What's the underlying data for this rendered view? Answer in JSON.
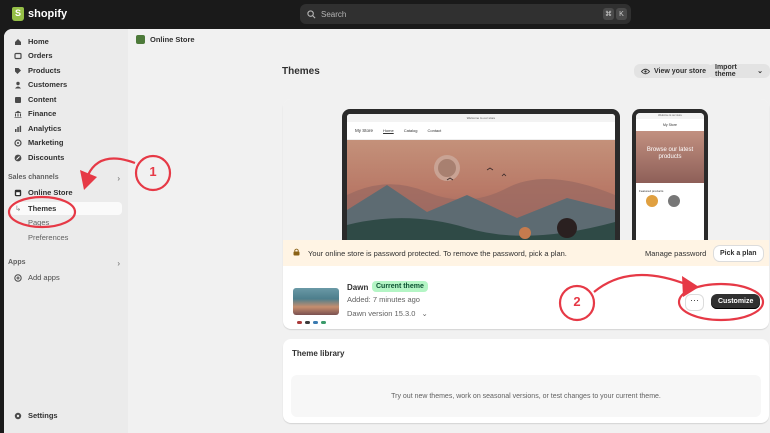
{
  "topbar": {
    "brand": "shopify",
    "search_placeholder": "Search",
    "shortcut_keys": [
      "⌘",
      "K"
    ]
  },
  "sidebar": {
    "items": [
      {
        "label": "Home",
        "icon": "home-icon"
      },
      {
        "label": "Orders",
        "icon": "orders-icon"
      },
      {
        "label": "Products",
        "icon": "tag-icon"
      },
      {
        "label": "Customers",
        "icon": "person-icon"
      },
      {
        "label": "Content",
        "icon": "content-icon"
      },
      {
        "label": "Finance",
        "icon": "bank-icon"
      },
      {
        "label": "Analytics",
        "icon": "chart-icon"
      },
      {
        "label": "Marketing",
        "icon": "target-icon"
      },
      {
        "label": "Discounts",
        "icon": "discount-icon"
      }
    ],
    "sales_channels_label": "Sales channels",
    "online_store_label": "Online Store",
    "sub_items": [
      "Themes",
      "Pages",
      "Preferences"
    ],
    "apps_label": "Apps",
    "add_apps_label": "Add apps",
    "settings_label": "Settings"
  },
  "main": {
    "breadcrumb": "Online Store",
    "title": "Themes",
    "view_store": "View your store",
    "import_theme": "Import theme",
    "preview": {
      "promo": "Welcome to our store",
      "store_name": "My Store",
      "nav": [
        "Home",
        "Catalog",
        "Contact"
      ],
      "mobile_headline": "Browse our latest products",
      "mobile_featured": "Featured products"
    },
    "banner": {
      "message": "Your online store is password protected. To remove the password, pick a plan.",
      "manage": "Manage password",
      "pick_plan": "Pick a plan"
    },
    "current_theme": {
      "name": "Dawn",
      "badge": "Current theme",
      "added": "Added: 7 minutes ago",
      "version": "Dawn version 15.3.0",
      "more": "···",
      "customize": "Customize"
    },
    "library": {
      "title": "Theme library",
      "empty_text": "Try out new themes, work on seasonal versions, or test changes to your current theme."
    }
  },
  "annotations": {
    "step1": "1",
    "step2": "2",
    "color": "#e63946"
  }
}
